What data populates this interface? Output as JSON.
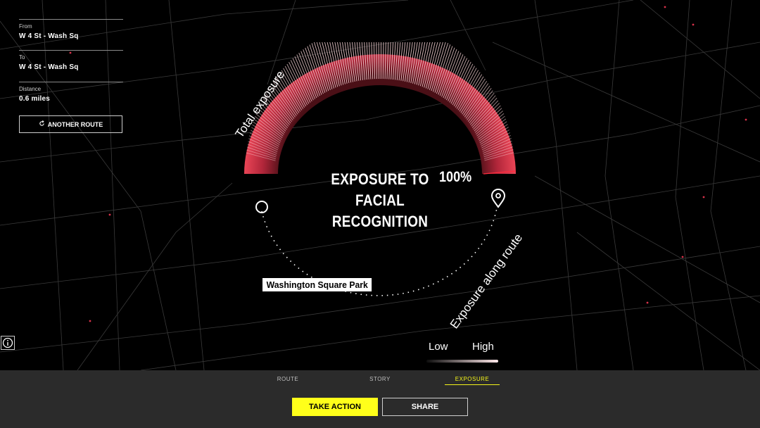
{
  "route": {
    "from_label": "From",
    "from_value": "W 4 St - Wash Sq",
    "to_label": "To",
    "to_value": "W 4 St - Wash Sq",
    "distance_label": "Distance",
    "distance_value": "0.6 miles",
    "another_route_label": "ANOTHER ROUTE",
    "another_route_icon": "refresh-icon"
  },
  "viz": {
    "title_line1": "EXPOSURE TO",
    "title_line2": "FACIAL RECOGNITION",
    "total_percent": "100%",
    "total_label": "Total exposure",
    "along_label": "Exposure along route",
    "place_label": "Washington Square Park",
    "legend_low": "Low",
    "legend_high": "High",
    "accent_color": "#e33b4c",
    "route_color": "#ffd9dc"
  },
  "tabs": {
    "route": "ROUTE",
    "story": "STORY",
    "exposure": "EXPOSURE",
    "active": "EXPOSURE"
  },
  "actions": {
    "take_action": "TAKE ACTION",
    "share": "SHARE"
  },
  "colors": {
    "highlight": "#ffff1a",
    "background": "#000000",
    "bottom_bar": "#2b2b2b"
  }
}
